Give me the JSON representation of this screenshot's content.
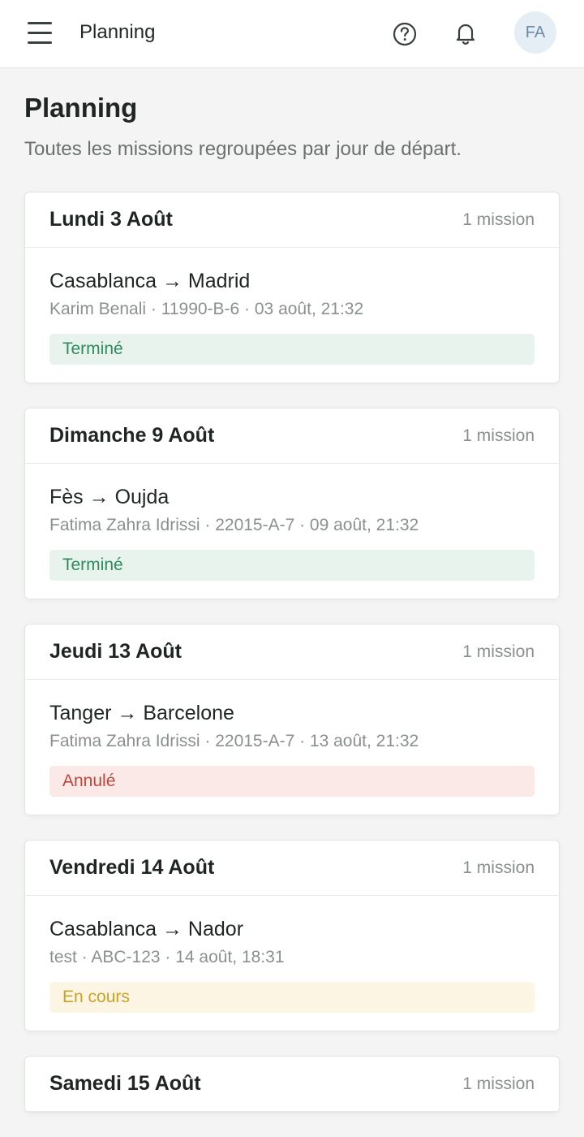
{
  "topbar": {
    "title": "Planning",
    "avatar_initials": "FA",
    "icons": [
      "menu-icon",
      "help-icon",
      "bell-icon"
    ]
  },
  "page": {
    "title": "Planning",
    "subtitle": "Toutes les missions regroupées par jour de départ."
  },
  "days": [
    {
      "label": "Lundi 3 Août",
      "count": "1 mission",
      "mission": {
        "route": "Casablanca → Madrid",
        "meta": "Karim Benali · 11990-B-6 · 03 août, 21:32",
        "status": "Terminé",
        "status_kind": "done"
      }
    },
    {
      "label": "Dimanche 9 Août",
      "count": "1 mission",
      "mission": {
        "route": "Fès → Oujda",
        "meta": "Fatima Zahra Idrissi · 22015-A-7 · 09 août, 21:32",
        "status": "Terminé",
        "status_kind": "done"
      }
    },
    {
      "label": "Jeudi 13 Août",
      "count": "1 mission",
      "mission": {
        "route": "Tanger → Barcelone",
        "meta": "Fatima Zahra Idrissi · 22015-A-7 · 13 août, 21:32",
        "status": "Annulé",
        "status_kind": "cancel"
      }
    },
    {
      "label": "Vendredi 14 Août",
      "count": "1 mission",
      "mission": {
        "route": "Casablanca → Nador",
        "meta": "test · ABC-123 · 14 août, 18:31",
        "status": "En cours",
        "status_kind": "progress"
      }
    },
    {
      "label": "Samedi 15 Août",
      "count": "1 mission"
    }
  ],
  "colors": {
    "done": "#2f8a5b",
    "cancel": "#c0473c",
    "progress": "#c9a227"
  }
}
